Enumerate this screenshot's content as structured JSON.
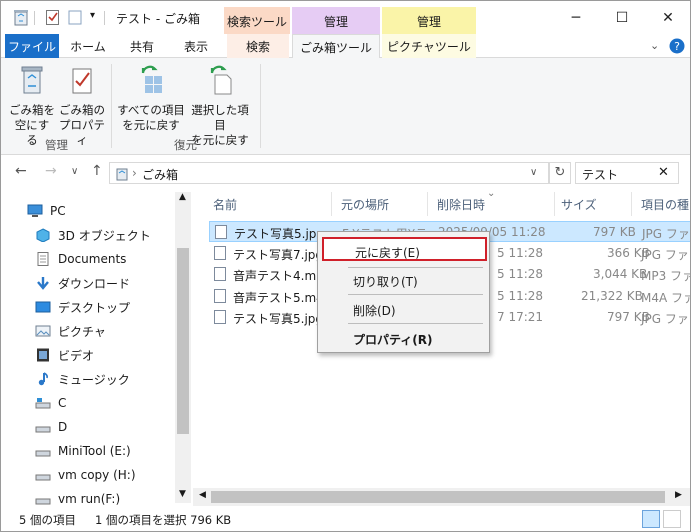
{
  "window": {
    "title": "テスト - ごみ箱",
    "contextual_tabs": {
      "search_tools": "検索ツール",
      "manage_1": "管理",
      "manage_2": "管理"
    },
    "controls": {
      "minimize": "─",
      "maximize": "☐",
      "close": "✕"
    }
  },
  "ribbon_tabs": {
    "file": "ファイル",
    "home": "ホーム",
    "share": "共有",
    "view": "表示",
    "search": "検索",
    "recycle_tools": "ごみ箱ツール",
    "picture_tools": "ピクチャツール"
  },
  "ribbon": {
    "empty_bin": "ごみ箱を\n空にする",
    "bin_props": "ごみ箱の\nプロパティ",
    "group_manage": "管理",
    "restore_all": "すべての項目\nを元に戻す",
    "restore_selected": "選択した項目\nを元に戻す",
    "group_restore": "復元"
  },
  "address": {
    "separator": "›",
    "location": "ごみ箱",
    "search_value": "テスト"
  },
  "nav": {
    "items": [
      "PC",
      "3D オブジェクト",
      "Documents",
      "ダウンロード",
      "デスクトップ",
      "ピクチャ",
      "ビデオ",
      "ミュージック",
      "C",
      "D",
      "MiniTool (E:)",
      "vm copy (H:)",
      "vm run(F:)"
    ]
  },
  "columns": {
    "name": "名前",
    "original_location": "元の場所",
    "date_deleted": "削除日時",
    "size": "サイズ",
    "item_type": "項目の種"
  },
  "files": [
    {
      "name": "テスト写真5.jpg",
      "location": "F:¥テスト用¥テ",
      "date": "2025/09/05 11:28",
      "size": "797 KB",
      "type": "JPG ファイ"
    },
    {
      "name": "テスト写真7.jpg",
      "location": "",
      "date": "5 11:28",
      "size": "366 KB",
      "type": "JPG ファイ"
    },
    {
      "name": "音声テスト4.mp3",
      "location": "",
      "date": "5 11:28",
      "size": "3,044 KB",
      "type": "MP3 ファイ"
    },
    {
      "name": "音声テスト5.m4a",
      "location": "",
      "date": "5 11:28",
      "size": "21,322 KB",
      "type": "M4A ファ"
    },
    {
      "name": "テスト写真5.jpg",
      "location": "",
      "date": "7 17:21",
      "size": "797 KB",
      "type": "JPG ファイ"
    }
  ],
  "context_menu": {
    "restore": "元に戻す(E)",
    "cut": "切り取り(T)",
    "delete": "削除(D)",
    "properties": "プロパティ(R)"
  },
  "status": {
    "count": "5 個の項目",
    "selected": "1 個の項目を選択 796 KB"
  },
  "colors": {
    "accent": "#1a6fc9",
    "search_tools_bg": "#fbd9c6",
    "manage_1_bg": "#e6ccf4",
    "manage_2_bg": "#faf4a8",
    "highlight_border": "#d0202a"
  }
}
